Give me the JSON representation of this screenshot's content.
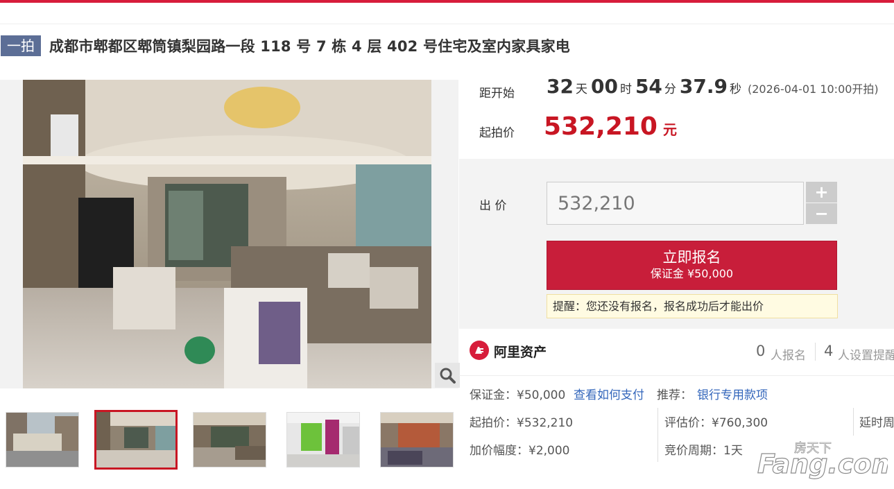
{
  "header": {
    "badge": "一拍",
    "title": "成都市郫都区郫筒镇梨园路一段 118 号 7 栋 4 层 402 号住宅及室内家具家电"
  },
  "countdown": {
    "label": "距开始",
    "days": "32",
    "days_unit": "天",
    "hours": "00",
    "hours_unit": "时",
    "minutes": "54",
    "minutes_unit": "分",
    "seconds": "37.9",
    "seconds_unit": "秒",
    "start_note": "(2026-04-01 10:00开拍)"
  },
  "start_price": {
    "label": "起拍价",
    "value": "532,210",
    "unit": "元"
  },
  "bid": {
    "label": "出 价",
    "input_value": "532,210",
    "plus": "+",
    "minus": "−",
    "register_label": "立即报名",
    "deposit_label": "保证金 ¥50,000",
    "tip": "提醒：您还没有报名，报名成功后才能出价"
  },
  "platform": {
    "name": "阿里资产",
    "signup_count": "0",
    "signup_text": "人报名",
    "reminder_count": "4",
    "reminder_text": "人设置提醒"
  },
  "details": {
    "deposit": "保证金：¥50,000",
    "how_to_pay": "查看如何支付",
    "recommend_label": "推荐：",
    "recommend_link": "银行专用款项",
    "start_price": "起拍价：¥532,210",
    "appraisal": "评估价：¥760,300",
    "delay": "延时周",
    "increment": "加价幅度：¥2,000",
    "period": "竞价周期：1天"
  },
  "watermark": {
    "top": "房天下",
    "brand": "Fang.com"
  },
  "colors": {
    "accent": "#c81623",
    "badge": "#5c6e96",
    "link": "#3366bb",
    "panel": "#f3f3f3"
  }
}
